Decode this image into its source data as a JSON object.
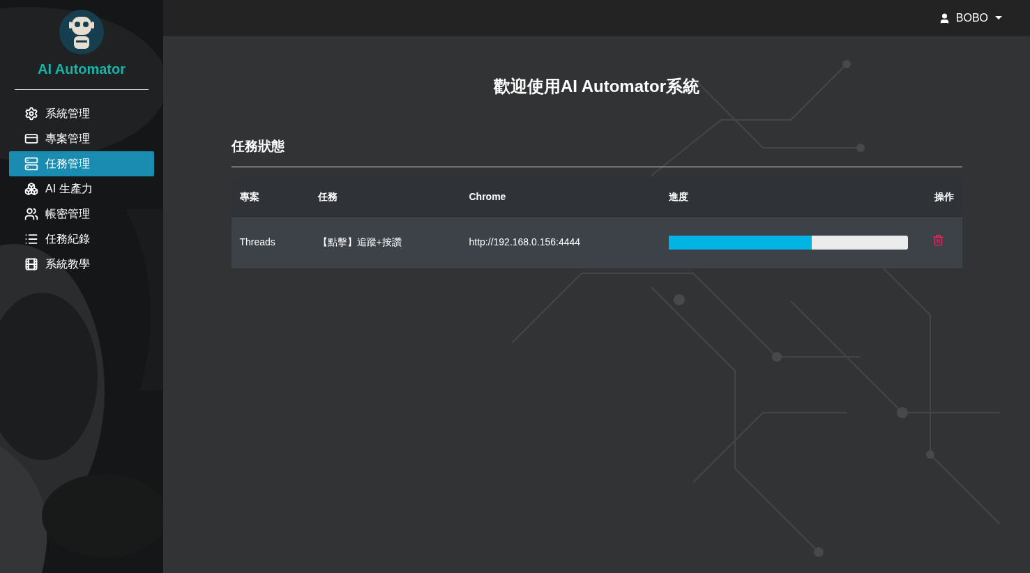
{
  "brand": {
    "name": "AI Automator"
  },
  "sidebar": {
    "items": [
      {
        "label": "系統管理",
        "selected": false
      },
      {
        "label": "專案管理",
        "selected": false
      },
      {
        "label": "任務管理",
        "selected": true
      },
      {
        "label": "AI 生產力",
        "selected": false
      },
      {
        "label": "帳密管理",
        "selected": false
      },
      {
        "label": "任務紀錄",
        "selected": false
      },
      {
        "label": "系統教學",
        "selected": false
      }
    ]
  },
  "header": {
    "user": "BOBO"
  },
  "title": "歡迎使用AI Automator系統",
  "section": {
    "title": "任務狀態"
  },
  "table": {
    "columns": [
      "專案",
      "任務",
      "Chrome",
      "進度",
      "操作"
    ],
    "rows": [
      {
        "project": "Threads",
        "task": "【點擊】追蹤+按讚",
        "chrome": "http://192.168.0.156:4444",
        "level": 0.6
      }
    ]
  }
}
